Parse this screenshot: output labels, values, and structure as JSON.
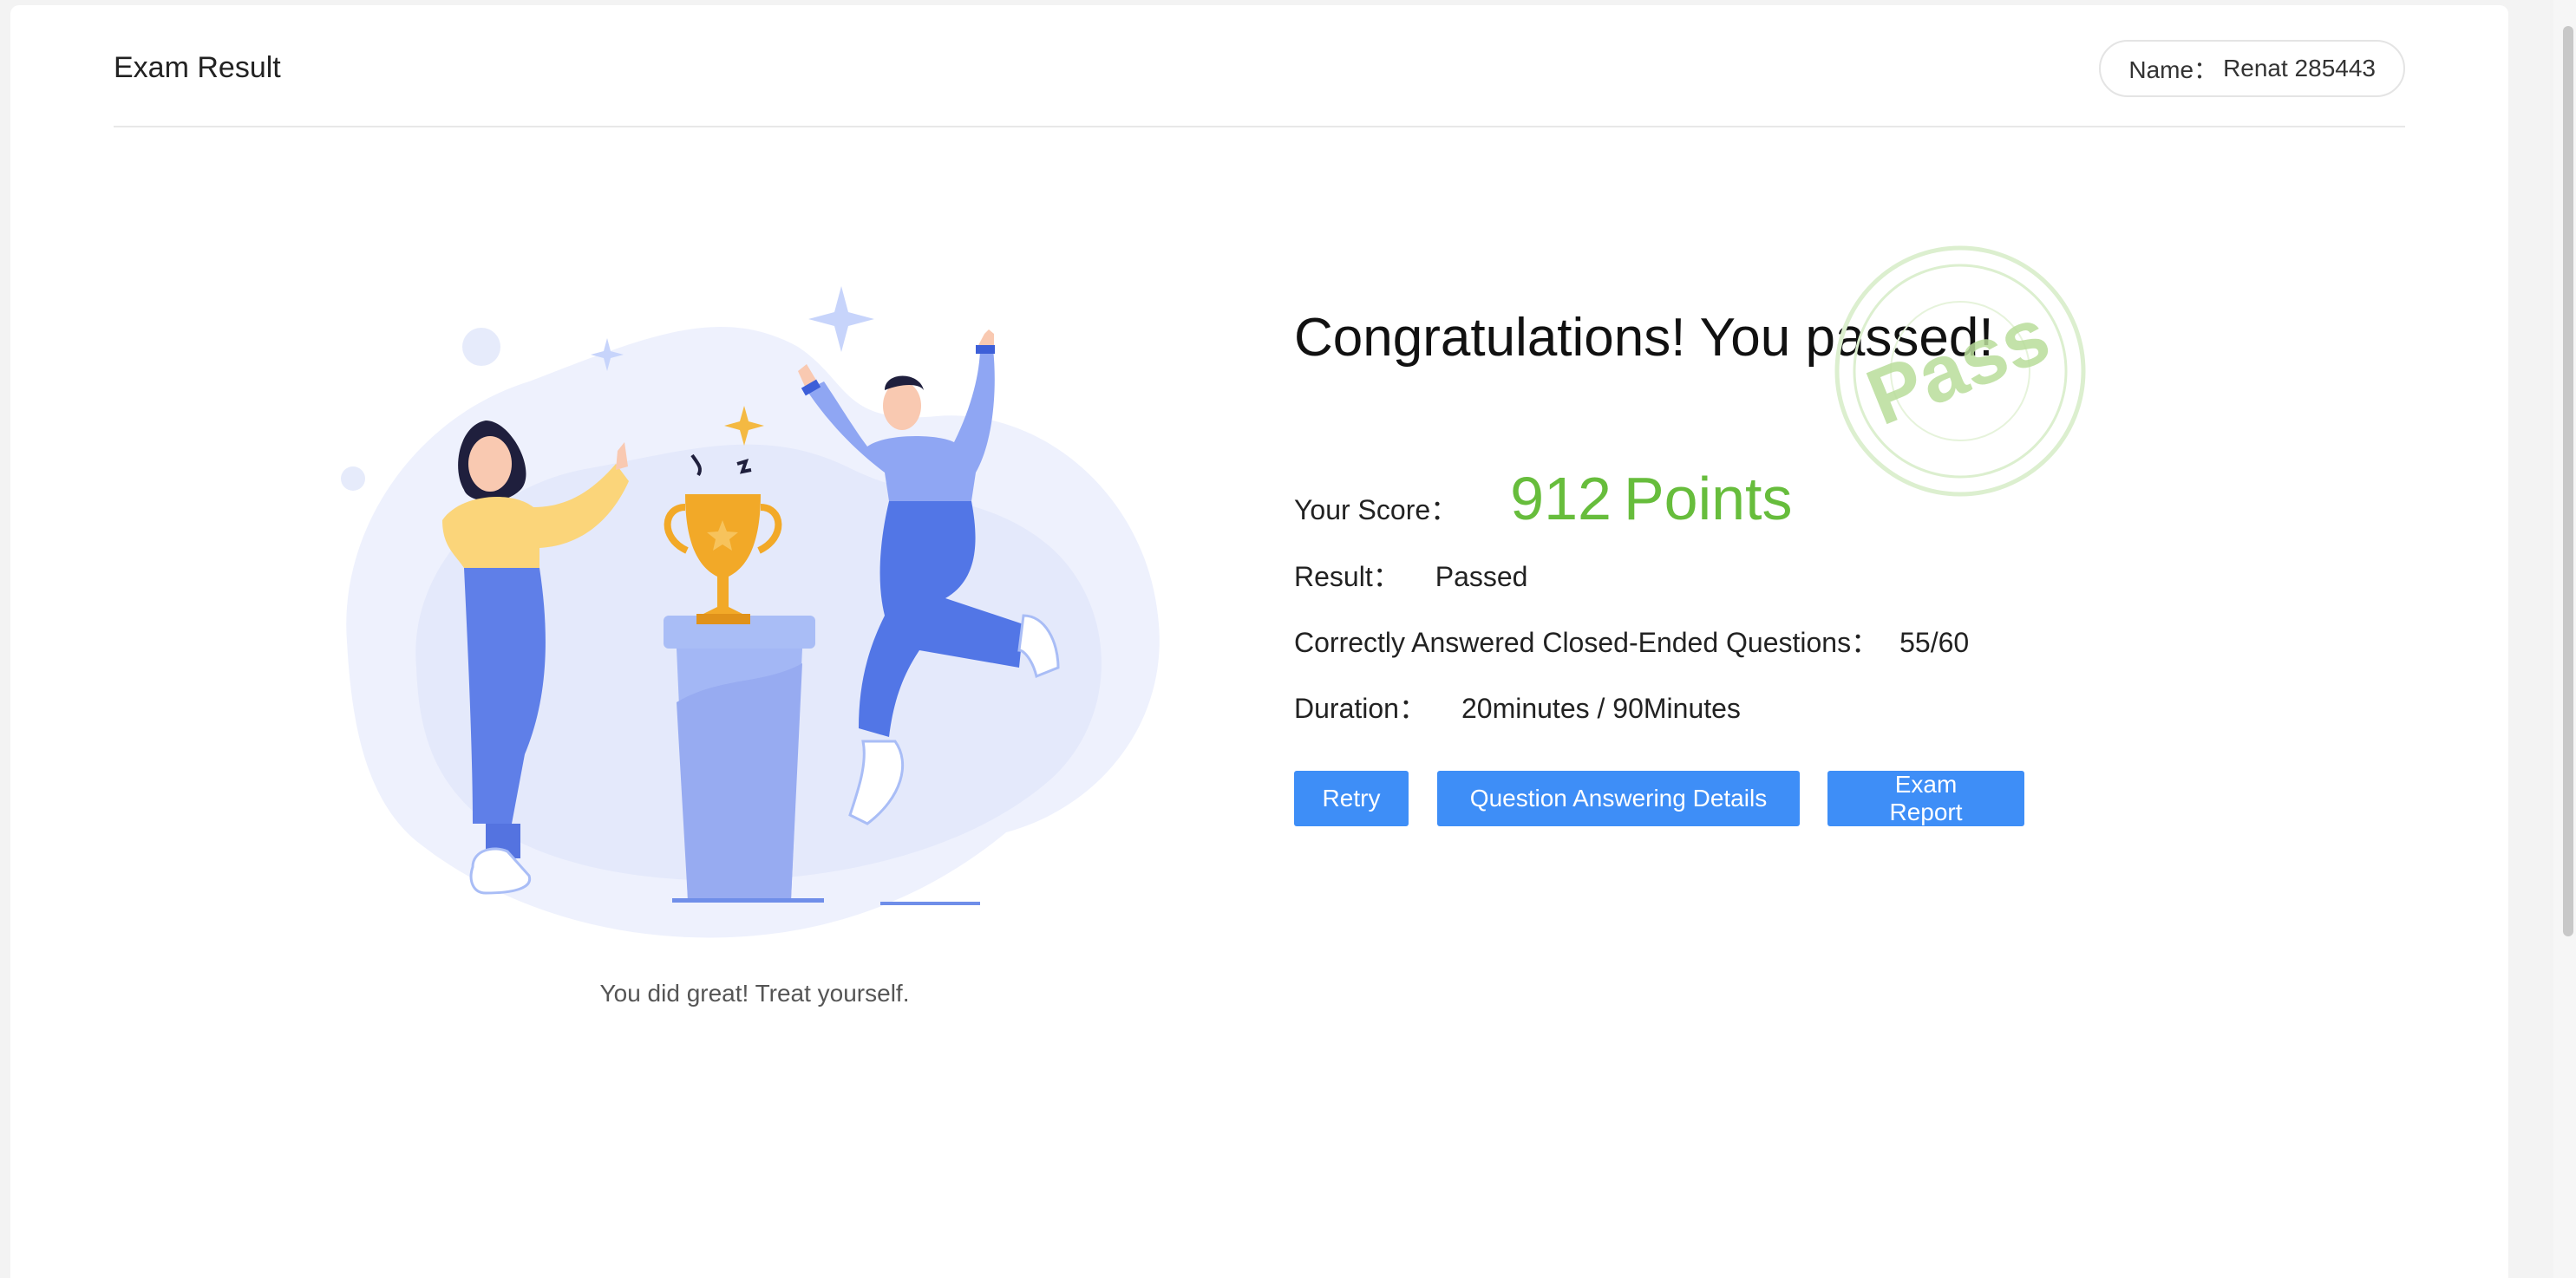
{
  "header": {
    "title": "Exam Result",
    "name_label": "Name：",
    "name_value": "Renat 285443"
  },
  "illustration": {
    "caption": "You did great! Treat yourself."
  },
  "result": {
    "headline": "Congratulations! You passed!",
    "stamp_text": "Pass",
    "score_label": "Your Score：",
    "score_value": "912",
    "score_unit": "Points",
    "result_label": "Result：",
    "result_value": "Passed",
    "correct_label": "Correctly Answered Closed-Ended Questions：",
    "correct_value": "55/60",
    "duration_label": "Duration：",
    "duration_value": "20minutes / 90Minutes"
  },
  "actions": {
    "retry": "Retry",
    "details": "Question Answering Details",
    "report": "Exam Report"
  },
  "colors": {
    "primary": "#3e8ef7",
    "score": "#67bd3c",
    "stamp": "#b9dd9b"
  }
}
